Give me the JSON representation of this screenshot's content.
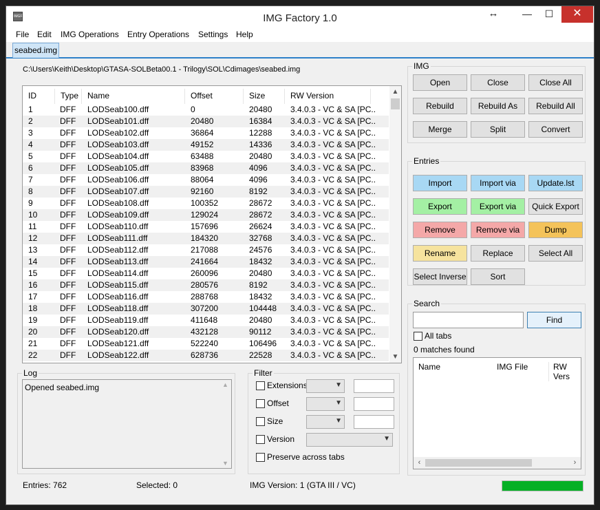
{
  "window": {
    "title": "IMG Factory 1.0",
    "icon_text": "IMGF",
    "resize_glyph": "↔",
    "min_glyph": "—",
    "max_glyph": "☐",
    "close_glyph": "✕"
  },
  "menu": [
    "File",
    "Edit",
    "IMG Operations",
    "Entry Operations",
    "Settings",
    "Help"
  ],
  "tabs": [
    {
      "label": "seabed.img",
      "active": true
    }
  ],
  "path": "C:\\Users\\Keith\\Desktop\\GTASA-SOLBeta00.1 - Trilogy\\SOL\\Cdimages\\seabed.img",
  "table": {
    "columns": [
      "ID",
      "Type",
      "Name",
      "Offset",
      "Size",
      "RW Version"
    ],
    "rows": [
      [
        "1",
        "DFF",
        "LODSeab100.dff",
        "0",
        "20480",
        "3.4.0.3 - VC & SA [PC..."
      ],
      [
        "2",
        "DFF",
        "LODSeab101.dff",
        "20480",
        "16384",
        "3.4.0.3 - VC & SA [PC..."
      ],
      [
        "3",
        "DFF",
        "LODSeab102.dff",
        "36864",
        "12288",
        "3.4.0.3 - VC & SA [PC..."
      ],
      [
        "4",
        "DFF",
        "LODSeab103.dff",
        "49152",
        "14336",
        "3.4.0.3 - VC & SA [PC..."
      ],
      [
        "5",
        "DFF",
        "LODSeab104.dff",
        "63488",
        "20480",
        "3.4.0.3 - VC & SA [PC..."
      ],
      [
        "6",
        "DFF",
        "LODSeab105.dff",
        "83968",
        "4096",
        "3.4.0.3 - VC & SA [PC..."
      ],
      [
        "7",
        "DFF",
        "LODSeab106.dff",
        "88064",
        "4096",
        "3.4.0.3 - VC & SA [PC..."
      ],
      [
        "8",
        "DFF",
        "LODSeab107.dff",
        "92160",
        "8192",
        "3.4.0.3 - VC & SA [PC..."
      ],
      [
        "9",
        "DFF",
        "LODSeab108.dff",
        "100352",
        "28672",
        "3.4.0.3 - VC & SA [PC..."
      ],
      [
        "10",
        "DFF",
        "LODSeab109.dff",
        "129024",
        "28672",
        "3.4.0.3 - VC & SA [PC..."
      ],
      [
        "11",
        "DFF",
        "LODSeab110.dff",
        "157696",
        "26624",
        "3.4.0.3 - VC & SA [PC..."
      ],
      [
        "12",
        "DFF",
        "LODSeab111.dff",
        "184320",
        "32768",
        "3.4.0.3 - VC & SA [PC..."
      ],
      [
        "13",
        "DFF",
        "LODSeab112.dff",
        "217088",
        "24576",
        "3.4.0.3 - VC & SA [PC..."
      ],
      [
        "14",
        "DFF",
        "LODSeab113.dff",
        "241664",
        "18432",
        "3.4.0.3 - VC & SA [PC..."
      ],
      [
        "15",
        "DFF",
        "LODSeab114.dff",
        "260096",
        "20480",
        "3.4.0.3 - VC & SA [PC..."
      ],
      [
        "16",
        "DFF",
        "LODSeab115.dff",
        "280576",
        "8192",
        "3.4.0.3 - VC & SA [PC..."
      ],
      [
        "17",
        "DFF",
        "LODSeab116.dff",
        "288768",
        "18432",
        "3.4.0.3 - VC & SA [PC..."
      ],
      [
        "18",
        "DFF",
        "LODSeab118.dff",
        "307200",
        "104448",
        "3.4.0.3 - VC & SA [PC..."
      ],
      [
        "19",
        "DFF",
        "LODSeab119.dff",
        "411648",
        "20480",
        "3.4.0.3 - VC & SA [PC..."
      ],
      [
        "20",
        "DFF",
        "LODSeab120.dff",
        "432128",
        "90112",
        "3.4.0.3 - VC & SA [PC..."
      ],
      [
        "21",
        "DFF",
        "LODSeab121.dff",
        "522240",
        "106496",
        "3.4.0.3 - VC & SA [PC..."
      ],
      [
        "22",
        "DFF",
        "LODSeab122.dff",
        "628736",
        "22528",
        "3.4.0.3 - VC & SA [PC..."
      ]
    ]
  },
  "img_group": {
    "title": "IMG",
    "buttons": [
      "Open",
      "Close",
      "Close All",
      "Rebuild",
      "Rebuild As",
      "Rebuild All",
      "Merge",
      "Split",
      "Convert"
    ]
  },
  "entries_group": {
    "title": "Entries",
    "buttons": [
      {
        "label": "Import",
        "color": "#a8d8f4"
      },
      {
        "label": "Import via",
        "color": "#a8d8f4"
      },
      {
        "label": "Update.lst",
        "color": "#a8d8f4"
      },
      {
        "label": "Export",
        "color": "#a4f0a4"
      },
      {
        "label": "Export via",
        "color": "#a4f0a4"
      },
      {
        "label": "Quick Export",
        "color": "#e1e1e1"
      },
      {
        "label": "Remove",
        "color": "#f4a8a8"
      },
      {
        "label": "Remove via",
        "color": "#f4a8a8"
      },
      {
        "label": "Dump",
        "color": "#f4c35a"
      },
      {
        "label": "Rename",
        "color": "#f6e39e"
      },
      {
        "label": "Replace",
        "color": "#e1e1e1"
      },
      {
        "label": "Select All",
        "color": "#e1e1e1"
      },
      {
        "label": "Select Inverse",
        "color": "#e1e1e1"
      },
      {
        "label": "Sort",
        "color": "#e1e1e1"
      }
    ]
  },
  "log": {
    "title": "Log",
    "text": "Opened seabed.img"
  },
  "filter": {
    "title": "Filter",
    "rows": [
      "Extensions",
      "Offset",
      "Size",
      "Version"
    ],
    "preserve_label": "Preserve across tabs"
  },
  "search": {
    "title": "Search",
    "placeholder": "",
    "find_label": "Find",
    "all_tabs_label": "All tabs",
    "matches": "0 matches found",
    "columns": [
      "Name",
      "IMG File",
      "RW Vers"
    ]
  },
  "status": {
    "entries": "Entries: 762",
    "selected": "Selected: 0",
    "img_version": "IMG Version: 1 (GTA III / VC)",
    "progress_fraction": 1.0,
    "progress_color": "#06b025"
  }
}
